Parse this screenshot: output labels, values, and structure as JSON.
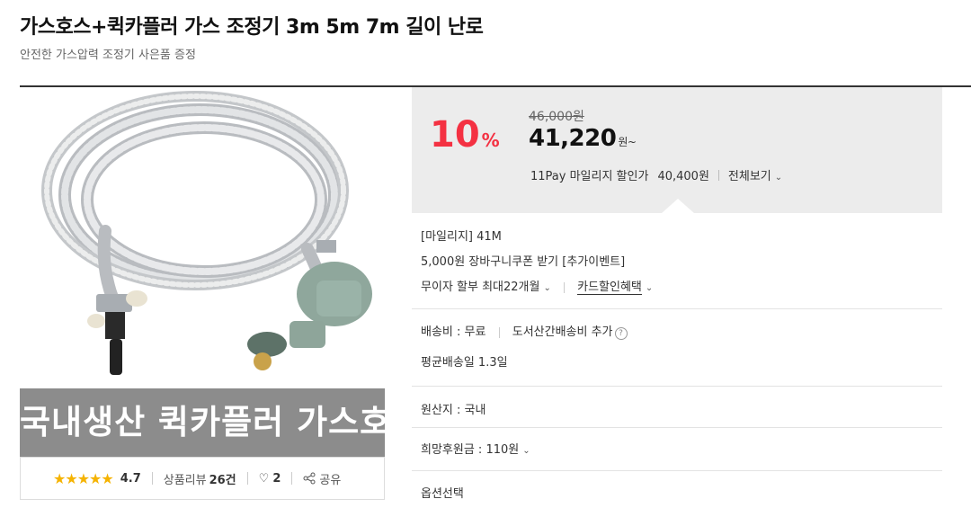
{
  "header": {
    "title": "가스호스+퀵카플러 가스 조정기 3m 5m 7m 길이 난로",
    "subtitle": "안전한 가스압력 조정기 사은품 증정"
  },
  "product_image": {
    "banner_text": "국내생산 퀵카플러 가스호스"
  },
  "rating": {
    "stars": "★★★★★",
    "score": "4.7",
    "review_label": "상품리뷰",
    "review_count": "26건",
    "like_count": "2",
    "share_label": "공유"
  },
  "price": {
    "discount": "10",
    "discount_unit": "%",
    "original": "46,000원",
    "current": "41,220",
    "current_suffix": "원~",
    "pay_label": "11Pay 마일리지 할인가",
    "pay_amount": "40,400원",
    "view_all": "전체보기"
  },
  "benefits": {
    "mileage": "[마일리지] 41M",
    "coupon": "5,000원 장바구니쿠폰 받기 [추가이벤트]",
    "installment": "무이자 할부 최대22개월",
    "card": "카드할인혜택"
  },
  "shipping": {
    "fee": "배송비 : 무료",
    "extra": "도서산간배송비 추가",
    "avg": "평균배송일 1.3일"
  },
  "origin": "원산지 : 국내",
  "after_reward": "희망후원금 : 110원",
  "option_label": "옵션선택",
  "colors": {
    "accent": "#f43142",
    "star": "#f5b301",
    "pricebox_bg": "#ececec"
  }
}
